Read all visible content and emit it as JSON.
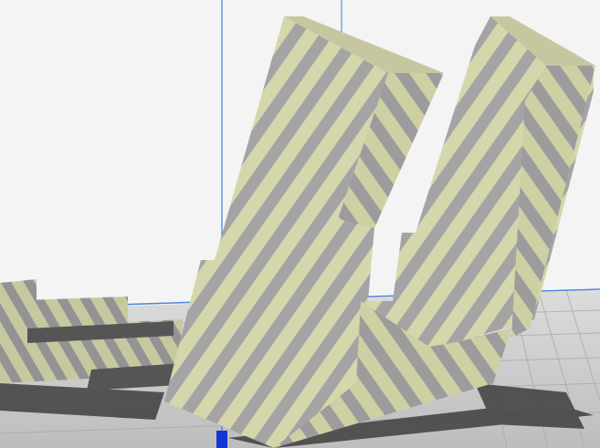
{
  "viewport": {
    "background_color": "#f4f4f4",
    "build_plate_color": "#c9c9c9",
    "grid_line_color": "#a9a9a9",
    "shadow_color": "#3e3e3e"
  },
  "model": {
    "stripe_light_color": "#d6d6ad",
    "stripe_dark_color": "#a4a4a4",
    "description_icon": "outside-build-volume-striped-model"
  },
  "axes": {
    "z_axis_color": "#3a7bd5",
    "origin_marker_color": "#1336d6"
  }
}
